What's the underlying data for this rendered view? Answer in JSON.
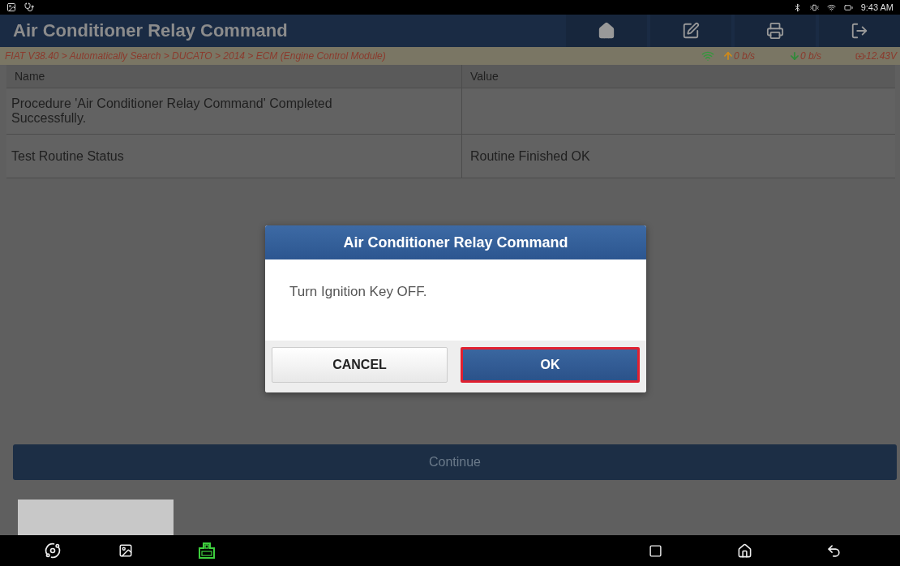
{
  "status_bar": {
    "time": "9:43 AM"
  },
  "header": {
    "title": "Air Conditioner Relay Command"
  },
  "info_bar": {
    "breadcrumb": "FIAT V38.40 > Automatically Search > DUCATO > 2014 > ECM (Engine Control Module)",
    "upload_rate": "0 b/s",
    "download_rate": "0 b/s",
    "voltage": "12.43V"
  },
  "table": {
    "columns": [
      "Name",
      "Value"
    ],
    "rows": [
      {
        "name": "Procedure 'Air Conditioner Relay Command' Completed Successfully.",
        "value": ""
      },
      {
        "name": "Test Routine Status",
        "value": "Routine Finished OK"
      }
    ]
  },
  "dialog": {
    "title": "Air Conditioner Relay Command",
    "message": "Turn Ignition Key OFF.",
    "buttons": [
      {
        "label": "CANCEL",
        "kind": "secondary",
        "selected": false
      },
      {
        "label": "OK",
        "kind": "primary",
        "selected": true
      }
    ]
  },
  "continue_button": {
    "label": "Continue"
  }
}
